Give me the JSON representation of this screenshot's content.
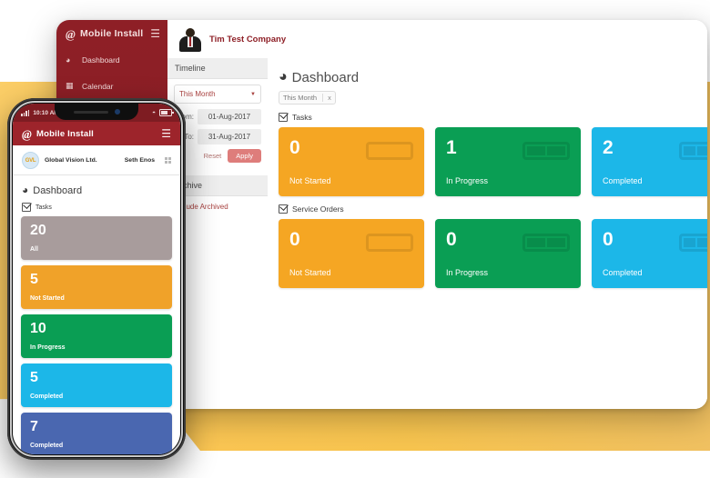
{
  "brand": {
    "name": "Mobile Install",
    "mark": "@",
    "colors": {
      "primary_red": "#8e1f26",
      "phone_red": "#9d242b",
      "orange": "#f5a623",
      "green": "#0a9e54",
      "blue": "#1cb7e8",
      "indigo": "#4a67b0",
      "salmon": "#e5695c",
      "gray": "#a89c9c",
      "yellow_band": "#f8c44f"
    }
  },
  "tablet": {
    "sidebar": {
      "items": [
        {
          "label": "Dashboard",
          "icon": "gauge-icon"
        },
        {
          "label": "Calendar",
          "icon": "calendar-icon"
        }
      ],
      "menu_icon": "hamburger-icon"
    },
    "topbar": {
      "company": "Tim Test Company",
      "avatar_icon": "user-avatar-icon"
    },
    "filters": {
      "timeline_header": "Timeline",
      "range_select": "This Month",
      "from_label": "From:",
      "from_value": "01-Aug-2017",
      "to_label": "To:",
      "to_value": "31-Aug-2017",
      "reset_label": "Reset",
      "apply_label": "Apply",
      "archive_header": "Archive",
      "include_archived_label": "Include Archived"
    },
    "dashboard": {
      "title": "Dashboard",
      "title_icon": "gauge-icon",
      "chip_label": "This Month",
      "chip_close": "x",
      "groups": [
        {
          "label": "Tasks",
          "cards": [
            {
              "value": "0",
              "label": "Not Started",
              "color": "#f5a623",
              "bars": 1
            },
            {
              "value": "1",
              "label": "In Progress",
              "color": "#0a9e54",
              "bars": 2
            },
            {
              "value": "2",
              "label": "Completed",
              "color": "#1cb7e8",
              "bars": 3
            },
            {
              "value": "",
              "label": "",
              "color": "#e5695c",
              "bars": 0
            }
          ]
        },
        {
          "label": "Service Orders",
          "cards": [
            {
              "value": "0",
              "label": "Not Started",
              "color": "#f5a623",
              "bars": 1
            },
            {
              "value": "0",
              "label": "In Progress",
              "color": "#0a9e54",
              "bars": 2
            },
            {
              "value": "0",
              "label": "Completed",
              "color": "#1cb7e8",
              "bars": 3
            },
            {
              "value": "",
              "label": "",
              "color": "#e5695c",
              "bars": 0
            }
          ]
        }
      ]
    }
  },
  "phone": {
    "status": {
      "time": "10:10 AM",
      "signal_icon": "signal-bars-icon",
      "wifi_icon": "wifi-icon",
      "battery_icon": "battery-icon"
    },
    "appbar": {
      "title": "Mobile Install",
      "mark": "@",
      "menu_icon": "hamburger-icon"
    },
    "user": {
      "org_initials": "GVL",
      "org_name": "Global Vision Ltd.",
      "user_name": "Seth Enos",
      "grid_icon": "grid-icon"
    },
    "dashboard": {
      "title": "Dashboard",
      "title_icon": "gauge-icon",
      "group_label": "Tasks",
      "cards": [
        {
          "value": "20",
          "label": "All",
          "color": "#a89c9c"
        },
        {
          "value": "5",
          "label": "Not Started",
          "color": "#f0a229"
        },
        {
          "value": "10",
          "label": "In Progress",
          "color": "#0a9e54"
        },
        {
          "value": "5",
          "label": "Completed",
          "color": "#1cb7e8"
        },
        {
          "value": "7",
          "label": "Completed",
          "color": "#4a67b0"
        },
        {
          "value": "",
          "label": "",
          "color": "#e5695c"
        }
      ]
    }
  }
}
